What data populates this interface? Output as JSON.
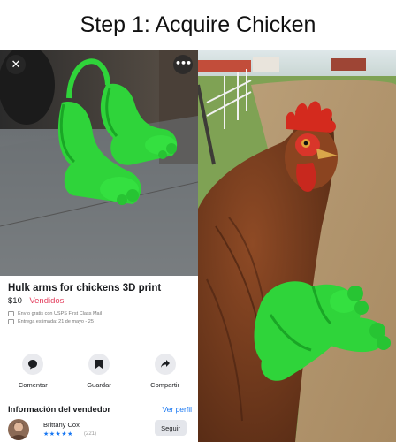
{
  "meme": {
    "title": "Step 1: Acquire Chicken"
  },
  "product": {
    "close_icon": "close-icon",
    "more_icon": "more-icon",
    "title": "Hulk arms for chickens 3D print",
    "price": "$10",
    "separator": " · ",
    "status": "Vendidos",
    "shipping": "Envío gratis con USPS First Class Mail",
    "delivery": "Entrega estimada: 21 de mayo - 25"
  },
  "actions": [
    {
      "label": "Comentar",
      "icon": "comment-icon"
    },
    {
      "label": "Guardar",
      "icon": "bookmark-icon"
    },
    {
      "label": "Compartir",
      "icon": "share-icon"
    }
  ],
  "seller": {
    "section_title": "Información del vendedor",
    "profile_link": "Ver perfil",
    "name": "Brittany Cox",
    "stars": "★★★★★",
    "rating_count": "(221)",
    "follow_label": "Seguir"
  },
  "colors": {
    "hulk_green": "#2fd43a",
    "link_blue": "#1877f2",
    "sold_red": "#e4405f"
  }
}
